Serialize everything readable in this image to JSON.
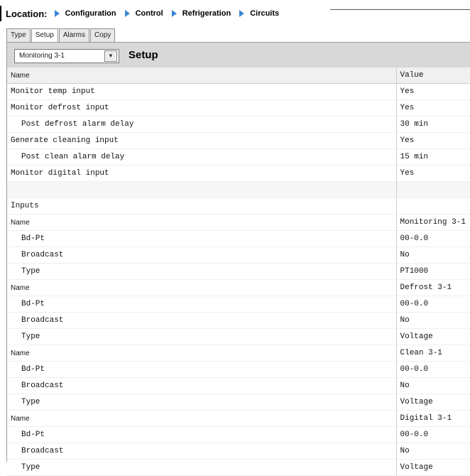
{
  "breadcrumb": {
    "label": "Location:",
    "items": [
      "Configuration",
      "Control",
      "Refrigeration",
      "Circuits"
    ]
  },
  "tabs": [
    "Type",
    "Setup",
    "Alarms",
    "Copy"
  ],
  "active_tab": "Setup",
  "header": {
    "select_value": "Monitoring 3-1",
    "title": "Setup"
  },
  "table": {
    "header": {
      "name": "Name",
      "value": "Value"
    },
    "rows": [
      {
        "name": "Monitor temp input",
        "value": "Yes",
        "indent": false
      },
      {
        "name": "Monitor defrost input",
        "value": "Yes",
        "indent": false
      },
      {
        "name": "Post defrost alarm delay",
        "value": "30 min",
        "indent": true
      },
      {
        "name": "Generate cleaning input",
        "value": "Yes",
        "indent": false
      },
      {
        "name": "Post clean alarm delay",
        "value": "15 min",
        "indent": true
      },
      {
        "name": "Monitor digital input",
        "value": "Yes",
        "indent": false
      }
    ],
    "section_label": "Inputs",
    "inputs": [
      {
        "name_label": "Name",
        "name_value": "Monitoring 3-1",
        "bdpt_label": "Bd-Pt",
        "bdpt_value": "00-0.0",
        "broadcast_label": "Broadcast",
        "broadcast_value": "No",
        "type_label": "Type",
        "type_value": "PT1000"
      },
      {
        "name_label": "Name",
        "name_value": "Defrost 3-1",
        "bdpt_label": "Bd-Pt",
        "bdpt_value": "00-0.0",
        "broadcast_label": "Broadcast",
        "broadcast_value": "No",
        "type_label": "Type",
        "type_value": "Voltage"
      },
      {
        "name_label": "Name",
        "name_value": "Clean 3-1",
        "bdpt_label": "Bd-Pt",
        "bdpt_value": "00-0.0",
        "broadcast_label": "Broadcast",
        "broadcast_value": "No",
        "type_label": "Type",
        "type_value": "Voltage"
      },
      {
        "name_label": "Name",
        "name_value": "Digital 3-1",
        "bdpt_label": "Bd-Pt",
        "bdpt_value": "00-0.0",
        "broadcast_label": "Broadcast",
        "broadcast_value": "No",
        "type_label": "Type",
        "type_value": "Voltage"
      }
    ]
  },
  "colors": {
    "breadcrumb_arrow": "#3d86d6",
    "header_bg": "#d8d8d8"
  },
  "icons": {
    "breadcrumb_arrow": "triangle-right-icon",
    "dropdown": "chevron-down-icon"
  }
}
